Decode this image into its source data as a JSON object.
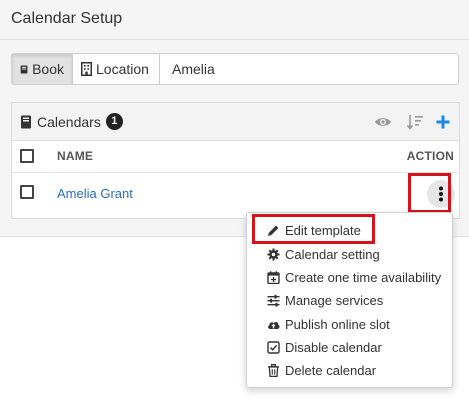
{
  "header": {
    "title": "Calendar Setup"
  },
  "filter": {
    "book_label": "Book",
    "location_label": "Location",
    "search_value": "Amelia"
  },
  "calendars": {
    "title": "Calendars",
    "count": "1",
    "columns": {
      "name": "NAME",
      "action": "ACTION"
    },
    "rows": [
      {
        "name": "Amelia Grant"
      }
    ]
  },
  "menu": {
    "items": [
      {
        "label": "Edit template",
        "icon": "pencil-icon"
      },
      {
        "label": "Calendar setting",
        "icon": "gear-icon"
      },
      {
        "label": "Create one time availability",
        "icon": "calendar-plus-icon"
      },
      {
        "label": "Manage services",
        "icon": "sliders-icon"
      },
      {
        "label": "Publish online slot",
        "icon": "cloud-upload-icon"
      },
      {
        "label": "Disable calendar",
        "icon": "checkbox-icon"
      },
      {
        "label": "Delete calendar",
        "icon": "trash-icon"
      }
    ]
  },
  "colors": {
    "link": "#2a6ebb",
    "accent_blue": "#1e88e5",
    "highlight_red": "#d6121a"
  }
}
